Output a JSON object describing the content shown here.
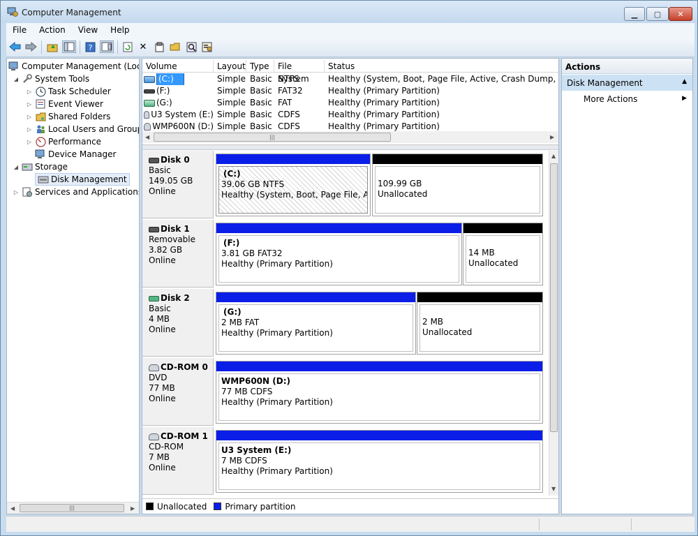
{
  "window": {
    "title": "Computer Management"
  },
  "menu": [
    "File",
    "Action",
    "View",
    "Help"
  ],
  "tree": {
    "root": "Computer Management (Local",
    "system_tools": "System Tools",
    "task_scheduler": "Task Scheduler",
    "event_viewer": "Event Viewer",
    "shared_folders": "Shared Folders",
    "local_users": "Local Users and Groups",
    "performance": "Performance",
    "device_manager": "Device Manager",
    "storage": "Storage",
    "disk_management": "Disk Management",
    "services": "Services and Applications",
    "scroll_grip": "|||"
  },
  "volumes": {
    "headers": [
      "Volume",
      "Layout",
      "Type",
      "File System",
      "Status"
    ],
    "rows": [
      {
        "volume": "(C:)",
        "layout": "Simple",
        "type": "Basic",
        "fs": "NTFS",
        "status": "Healthy (System, Boot, Page File, Active, Crash Dump, Primary"
      },
      {
        "volume": "(F:)",
        "layout": "Simple",
        "type": "Basic",
        "fs": "FAT32",
        "status": "Healthy (Primary Partition)"
      },
      {
        "volume": "(G:)",
        "layout": "Simple",
        "type": "Basic",
        "fs": "FAT",
        "status": "Healthy (Primary Partition)"
      },
      {
        "volume": "U3 System (E:)",
        "layout": "Simple",
        "type": "Basic",
        "fs": "CDFS",
        "status": "Healthy (Primary Partition)"
      },
      {
        "volume": "WMP600N (D:)",
        "layout": "Simple",
        "type": "Basic",
        "fs": "CDFS",
        "status": "Healthy (Primary Partition)"
      }
    ],
    "scroll_grip": "|||"
  },
  "disks": [
    {
      "name": "Disk 0",
      "type": "Basic",
      "size": "149.05 GB",
      "state": "Online",
      "p1": {
        "name": "(C:)",
        "size": "39.06 GB NTFS",
        "status": "Healthy (System, Boot, Page File, Active"
      },
      "p2": {
        "size": "109.99 GB",
        "status": "Unallocated"
      }
    },
    {
      "name": "Disk 1",
      "type": "Removable",
      "size": "3.82 GB",
      "state": "Online",
      "p1": {
        "name": "(F:)",
        "size": "3.81 GB FAT32",
        "status": "Healthy (Primary Partition)"
      },
      "p2": {
        "size": "14 MB",
        "status": "Unallocated"
      }
    },
    {
      "name": "Disk 2",
      "type": "Basic",
      "size": "4 MB",
      "state": "Online",
      "p1": {
        "name": "(G:)",
        "size": "2 MB FAT",
        "status": "Healthy (Primary Partition)"
      },
      "p2": {
        "size": "2 MB",
        "status": "Unallocated"
      }
    },
    {
      "name": "CD-ROM 0",
      "type": "DVD",
      "size": "77 MB",
      "state": "Online",
      "p1": {
        "name": "WMP600N  (D:)",
        "size": "77 MB CDFS",
        "status": "Healthy (Primary Partition)"
      }
    },
    {
      "name": "CD-ROM 1",
      "type": "CD-ROM",
      "size": "7 MB",
      "state": "Online",
      "p1": {
        "name": "U3 System  (E:)",
        "size": "7 MB CDFS",
        "status": "Healthy (Primary Partition)"
      }
    }
  ],
  "legend": {
    "unallocated": "Unallocated",
    "primary": "Primary partition"
  },
  "actions": {
    "title": "Actions",
    "section": "Disk Management",
    "more": "More Actions"
  },
  "colors": {
    "primary": "#0a1ee8",
    "unallocated": "#000000"
  },
  "icons": [
    "back-arrow-icon",
    "forward-arrow-icon",
    "up-folder-icon",
    "show-tree-icon",
    "help-icon",
    "console-icon",
    "refresh-icon",
    "delete-icon",
    "properties-icon",
    "open-icon",
    "search-icon",
    "settings-icon"
  ]
}
